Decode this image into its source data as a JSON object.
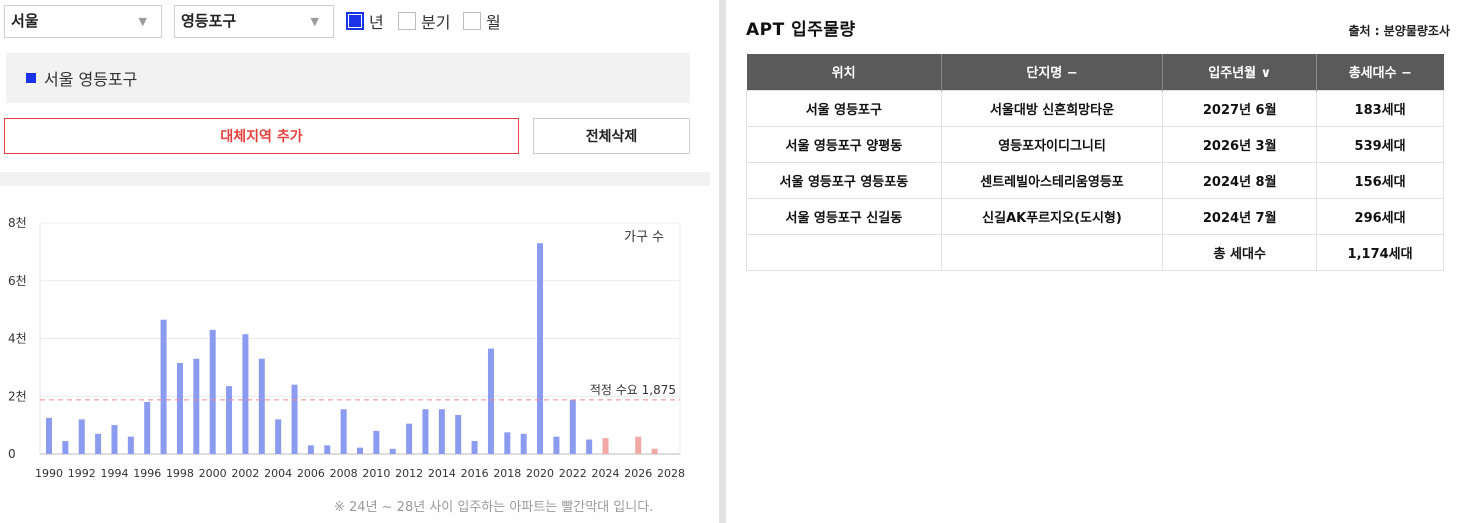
{
  "filters": {
    "region": "서울",
    "district": "영등포구",
    "period_options": [
      {
        "label": "년",
        "checked": true
      },
      {
        "label": "분기",
        "checked": false
      },
      {
        "label": "월",
        "checked": false
      }
    ]
  },
  "selected_region_label": "서울 영등포구",
  "buttons": {
    "add_region": "대체지역 추가",
    "delete_all": "전체삭제"
  },
  "colors": {
    "accent_blue": "#1a33e6",
    "bar_blue": "#8b9bf0",
    "bar_red": "#f2a9a6",
    "threshold_line": "#f08a8a",
    "button_red": "#e4403f"
  },
  "chart_data": {
    "type": "bar",
    "categories": [
      "1990",
      "1991",
      "1992",
      "1993",
      "1994",
      "1995",
      "1996",
      "1997",
      "1998",
      "1999",
      "2000",
      "2001",
      "2002",
      "2003",
      "2004",
      "2005",
      "2006",
      "2007",
      "2008",
      "2009",
      "2010",
      "2011",
      "2012",
      "2013",
      "2014",
      "2015",
      "2016",
      "2017",
      "2018",
      "2019",
      "2020",
      "2021",
      "2022",
      "2023",
      "2024",
      "2025",
      "2026",
      "2027",
      "2028"
    ],
    "values": [
      1250,
      450,
      1200,
      700,
      1000,
      600,
      1800,
      4650,
      3150,
      3300,
      4300,
      2350,
      4150,
      3300,
      1200,
      2400,
      300,
      300,
      1550,
      220,
      800,
      180,
      1050,
      1550,
      1550,
      1350,
      450,
      3650,
      750,
      700,
      7300,
      600,
      1875,
      500,
      550,
      0,
      600,
      183,
      0
    ],
    "forecast_from_index": 34,
    "legend": "가구 수",
    "ylim": [
      0,
      8000
    ],
    "yticks": [
      {
        "v": 0,
        "label": "0"
      },
      {
        "v": 2000,
        "label": "2천"
      },
      {
        "v": 4000,
        "label": "4천"
      },
      {
        "v": 6000,
        "label": "6천"
      },
      {
        "v": 8000,
        "label": "8천"
      }
    ],
    "xtick_labels": [
      "1990",
      "1992",
      "1994",
      "1996",
      "1998",
      "2000",
      "2002",
      "2004",
      "2006",
      "2008",
      "2010",
      "2012",
      "2014",
      "2016",
      "2018",
      "2020",
      "2022",
      "2024",
      "2026",
      "2028"
    ],
    "threshold": {
      "value": 1875,
      "label": "적정 수요 1,875"
    }
  },
  "chart_note": "※ 24년 ~ 28년 사이 입주하는 아파트는 빨간막대 입니다.",
  "apt": {
    "title": "APT 입주물량",
    "source": "출처 : 분양물량조사",
    "headers": [
      "위치",
      "단지명 −",
      "입주년월 ∨",
      "총세대수 −"
    ],
    "rows": [
      [
        "서울 영등포구",
        "서울대방 신혼희망타운",
        "2027년 6월",
        "183세대"
      ],
      [
        "서울 영등포구 양평동",
        "영등포자이디그니티",
        "2026년 3월",
        "539세대"
      ],
      [
        "서울 영등포구 영등포동",
        "센트레빌아스테리움영등포",
        "2024년 8월",
        "156세대"
      ],
      [
        "서울 영등포구 신길동",
        "신길AK푸르지오(도시형)",
        "2024년 7월",
        "296세대"
      ]
    ],
    "total_label": "총 세대수",
    "total_value": "1,174세대"
  }
}
